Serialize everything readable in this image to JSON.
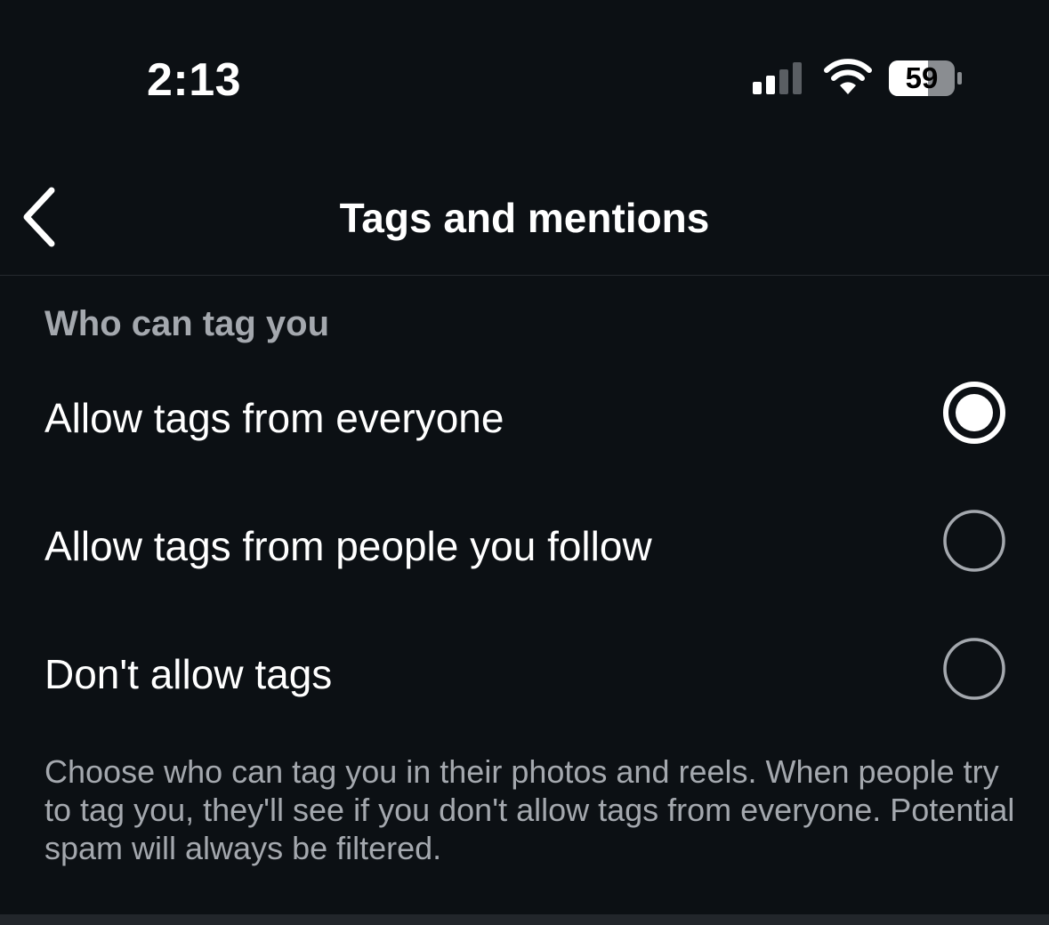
{
  "status_bar": {
    "time": "2:13",
    "battery_percent": "59",
    "signal_bars_active": 2,
    "signal_bars_total": 4
  },
  "header": {
    "title": "Tags and mentions",
    "back_icon": "chevron-left-icon"
  },
  "section": {
    "title": "Who can tag you",
    "options": [
      {
        "label": "Allow tags from everyone",
        "selected": true
      },
      {
        "label": "Allow tags from people you follow",
        "selected": false
      },
      {
        "label": "Don't allow tags",
        "selected": false
      }
    ],
    "description": "Choose who can tag you in their photos and reels. When people try to tag you, they'll see if you don't allow tags from everyone. Potential spam will always be filtered."
  },
  "colors": {
    "background": "#0c1014",
    "primary_text": "#ffffff",
    "secondary_text": "#a4a8ae",
    "radio_unselected": "#a4a8ae"
  }
}
